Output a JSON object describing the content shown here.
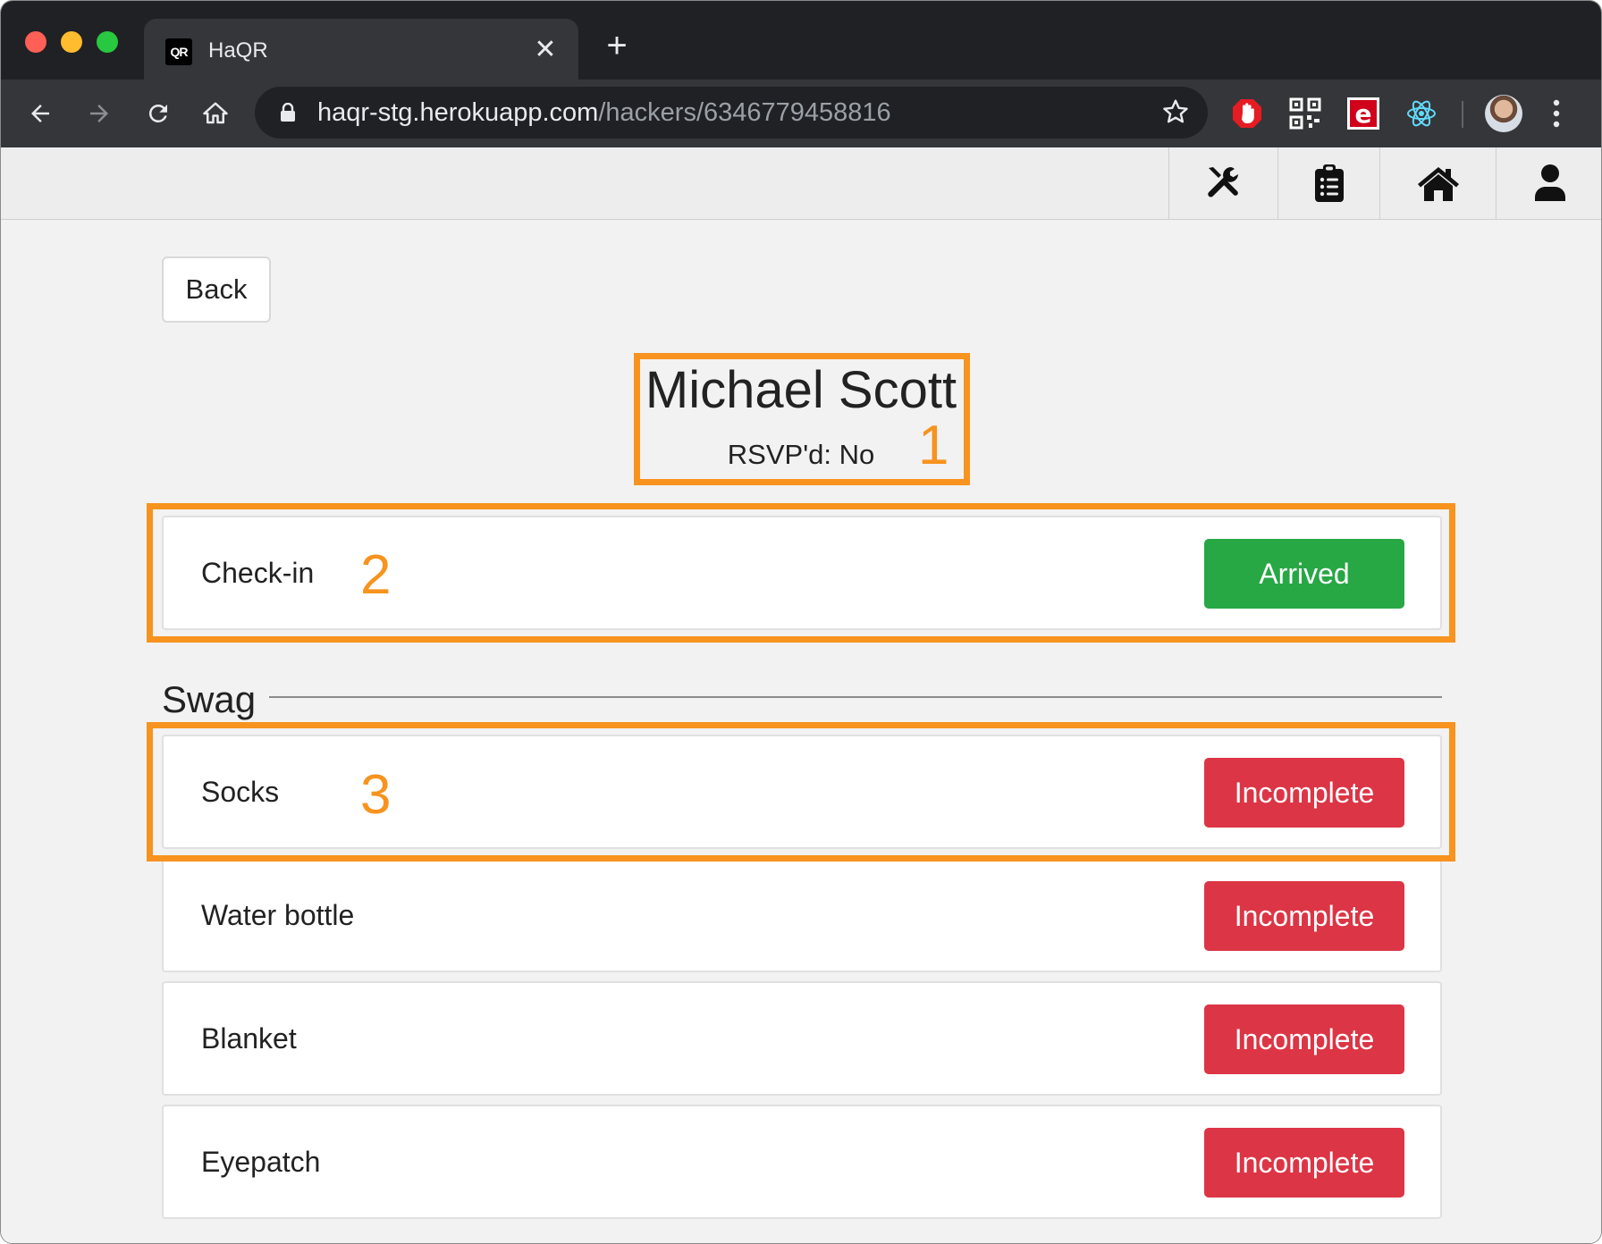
{
  "browser": {
    "tab_title": "HaQR",
    "tab_favicon_text": "QR",
    "tab_close": "✕",
    "new_tab": "+",
    "url_domain": "haqr-stg.herokuapp.com",
    "url_path": "/hackers/6346779458816"
  },
  "app_nav": {
    "items": [
      "tools-icon",
      "clipboard-list-icon",
      "home-icon",
      "user-icon"
    ]
  },
  "page": {
    "back_label": "Back",
    "hacker_name": "Michael Scott",
    "rsvp": "RSVP'd: No",
    "checkin": {
      "label": "Check-in",
      "status": "Arrived",
      "status_color": "#28a745"
    },
    "swag_title": "Swag",
    "swag_items": [
      {
        "label": "Socks",
        "status": "Incomplete",
        "status_color": "#dc3545"
      },
      {
        "label": "Water bottle",
        "status": "Incomplete",
        "status_color": "#dc3545"
      },
      {
        "label": "Blanket",
        "status": "Incomplete",
        "status_color": "#dc3545"
      },
      {
        "label": "Eyepatch",
        "status": "Incomplete",
        "status_color": "#dc3545"
      }
    ]
  },
  "annotations": {
    "color": "#f7931e",
    "labels": [
      "1",
      "2",
      "3"
    ]
  }
}
